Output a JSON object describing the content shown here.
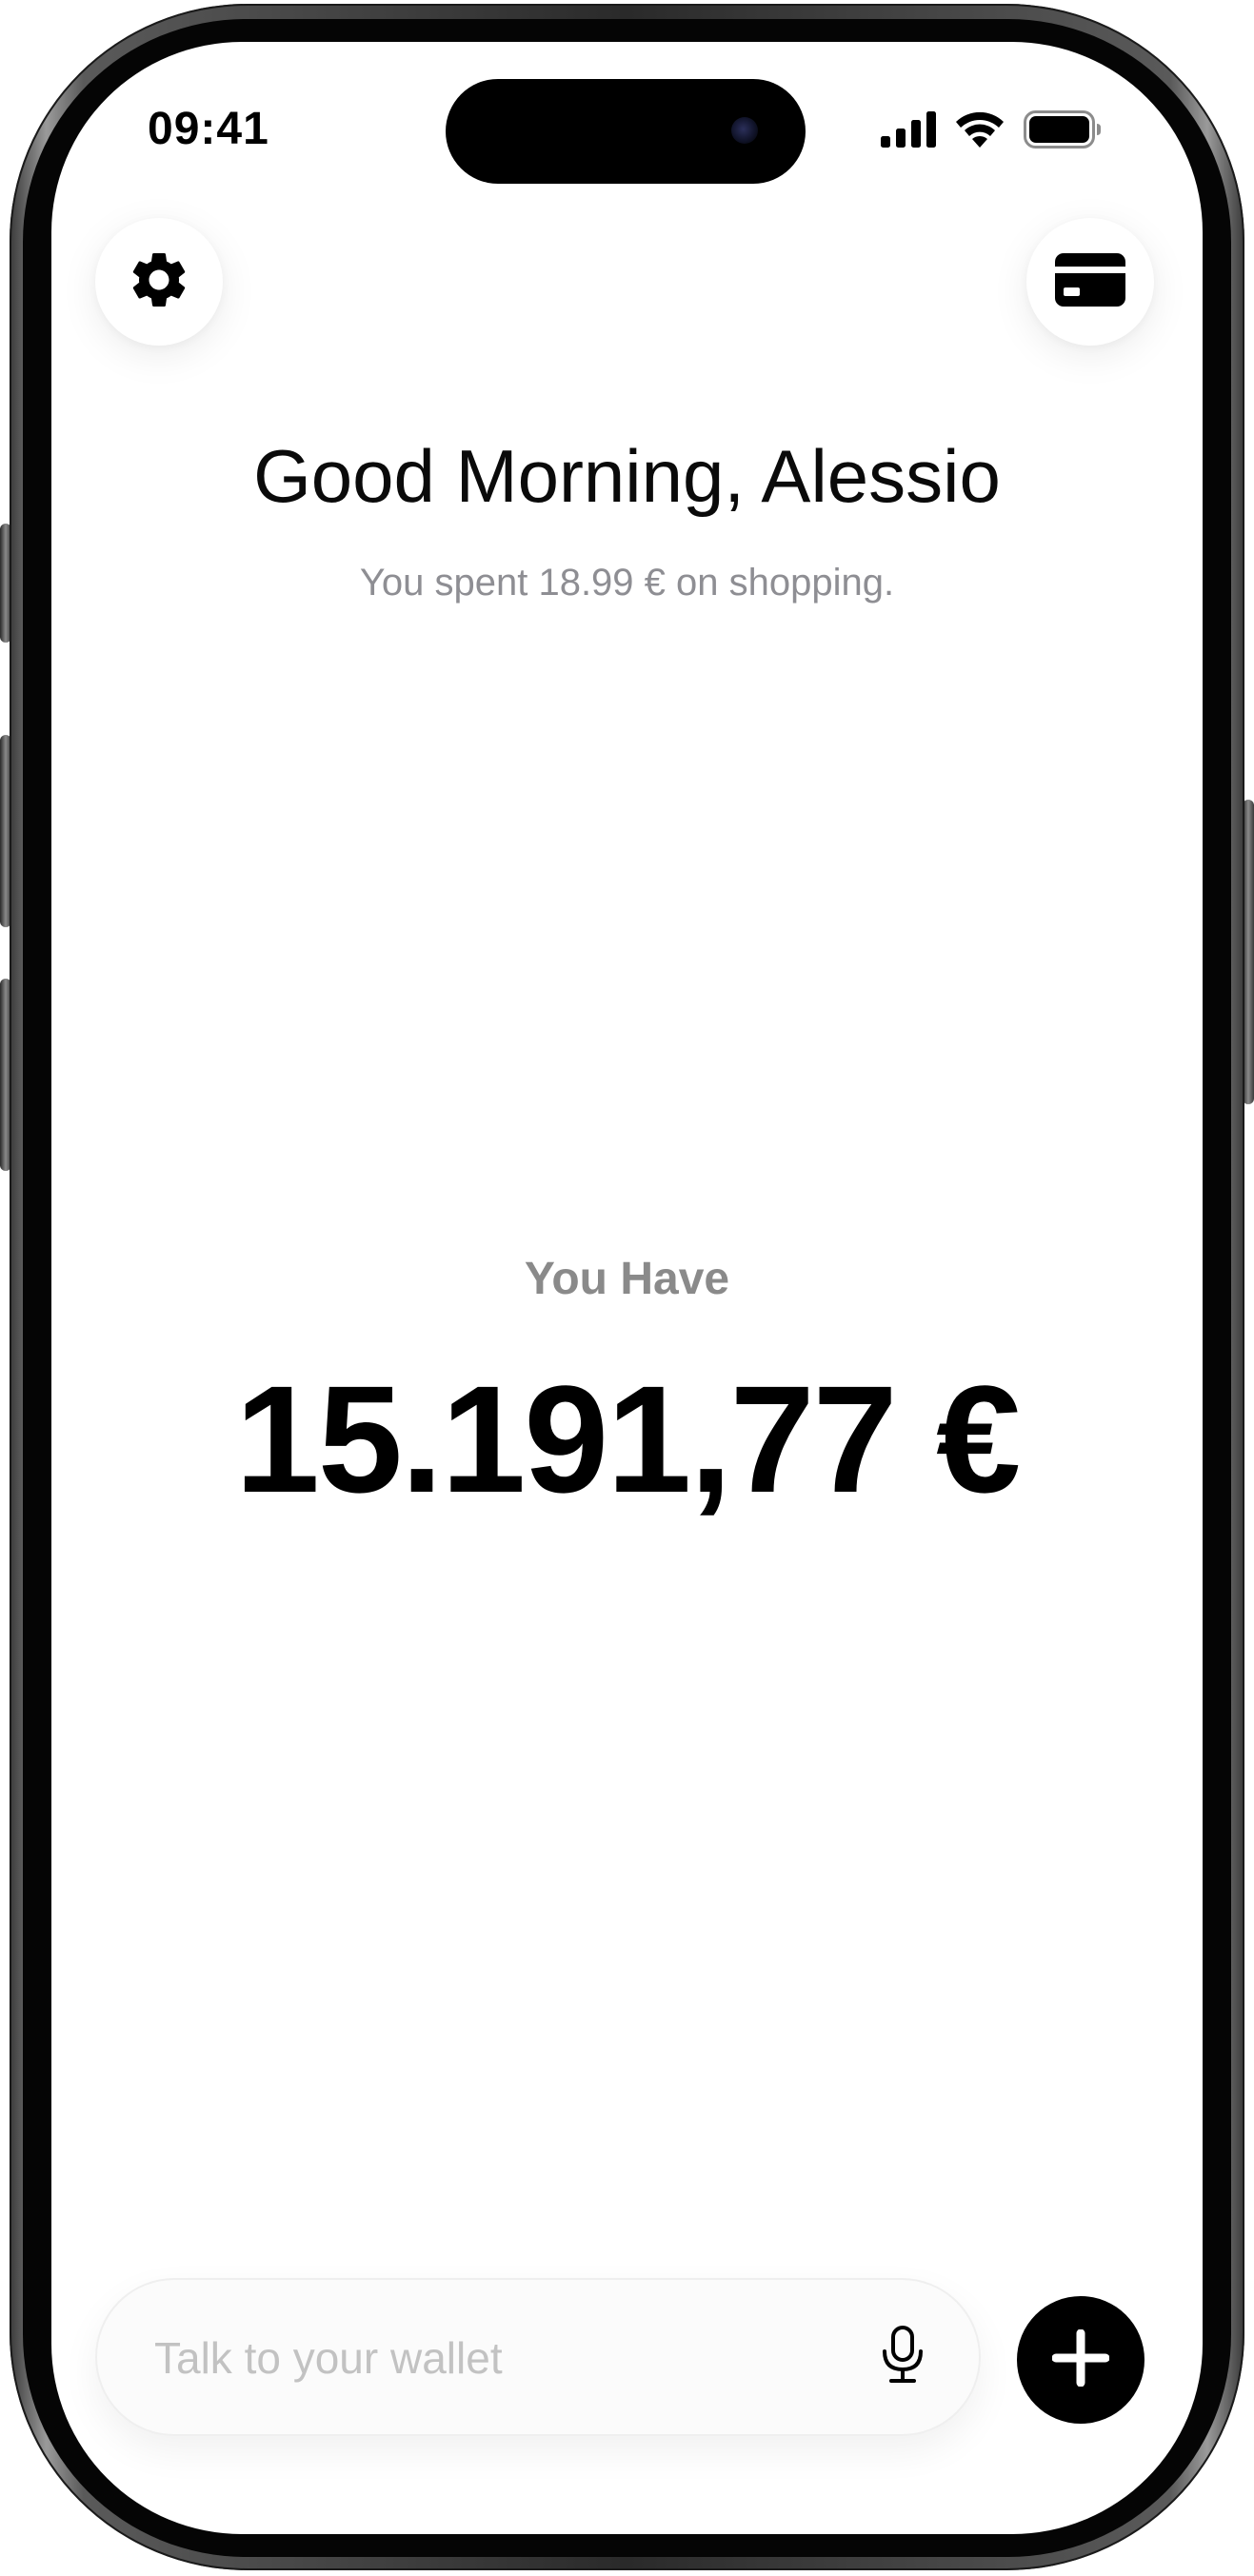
{
  "status_bar": {
    "time": "09:41",
    "icons": [
      "cellular-signal-icon",
      "wifi-icon",
      "battery-icon"
    ]
  },
  "header": {
    "settings_icon": "gear-icon",
    "cards_icon": "credit-card-icon"
  },
  "greeting": {
    "title": "Good Morning, Alessio",
    "subtitle": "You spent 18.99 € on shopping."
  },
  "balance": {
    "label": "You Have",
    "amount": "15.191,77 €"
  },
  "composer": {
    "placeholder": "Talk to your wallet",
    "value": "",
    "mic_icon": "microphone-icon",
    "add_icon": "plus-icon"
  },
  "colors": {
    "accent": "#000000",
    "muted_text": "#8e8e93",
    "placeholder": "#c2c2c2",
    "background": "#ffffff"
  }
}
